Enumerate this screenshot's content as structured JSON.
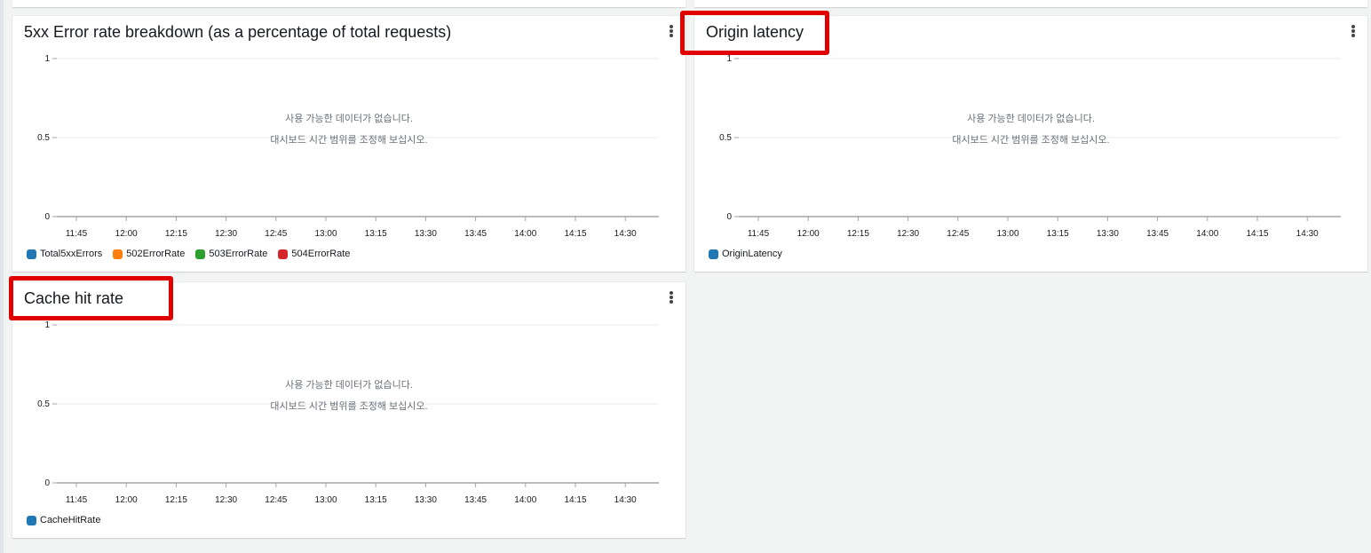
{
  "panels": [
    {
      "id": "error-rate",
      "title": "5xx Error rate breakdown (as a percentage of total requests)",
      "nodata_line1": "사용 가능한 데이터가 없습니다.",
      "nodata_line2": "대시보드 시간 범위를 조정해 보십시오.",
      "legend": [
        {
          "label": "Total5xxErrors",
          "color": "#1f77b4"
        },
        {
          "label": "502ErrorRate",
          "color": "#ff7f0e"
        },
        {
          "label": "503ErrorRate",
          "color": "#2ca02c"
        },
        {
          "label": "504ErrorRate",
          "color": "#d62728"
        }
      ]
    },
    {
      "id": "origin-latency",
      "title": "Origin latency",
      "nodata_line1": "사용 가능한 데이터가 없습니다.",
      "nodata_line2": "대시보드 시간 범위를 조정해 보십시오.",
      "legend": [
        {
          "label": "OriginLatency",
          "color": "#1f77b4"
        }
      ]
    },
    {
      "id": "cache-hit-rate",
      "title": "Cache hit rate",
      "nodata_line1": "사용 가능한 데이터가 없습니다.",
      "nodata_line2": "대시보드 시간 범위를 조정해 보십시오.",
      "legend": [
        {
          "label": "CacheHitRate",
          "color": "#1f77b4"
        }
      ]
    }
  ],
  "chart_data": [
    {
      "type": "line",
      "title": "5xx Error rate breakdown (as a percentage of total requests)",
      "x": [
        "11:45",
        "12:00",
        "12:15",
        "12:30",
        "12:45",
        "13:00",
        "13:15",
        "13:30",
        "13:45",
        "14:00",
        "14:15",
        "14:30"
      ],
      "yticks": [
        "0",
        "0.5",
        "1"
      ],
      "ylim": [
        0,
        1
      ],
      "grid": true,
      "legend_position": "bottom-left",
      "series": []
    },
    {
      "type": "line",
      "title": "Origin latency",
      "x": [
        "11:45",
        "12:00",
        "12:15",
        "12:30",
        "12:45",
        "13:00",
        "13:15",
        "13:30",
        "13:45",
        "14:00",
        "14:15",
        "14:30"
      ],
      "yticks": [
        "0",
        "0.5",
        "1"
      ],
      "ylim": [
        0,
        1
      ],
      "grid": true,
      "legend_position": "bottom-left",
      "series": []
    },
    {
      "type": "line",
      "title": "Cache hit rate",
      "x": [
        "11:45",
        "12:00",
        "12:15",
        "12:30",
        "12:45",
        "13:00",
        "13:15",
        "13:30",
        "13:45",
        "14:00",
        "14:15",
        "14:30"
      ],
      "yticks": [
        "0",
        "0.5",
        "1"
      ],
      "ylim": [
        0,
        1
      ],
      "grid": true,
      "legend_position": "bottom-left",
      "series": []
    }
  ],
  "highlight_color": "#e00000"
}
